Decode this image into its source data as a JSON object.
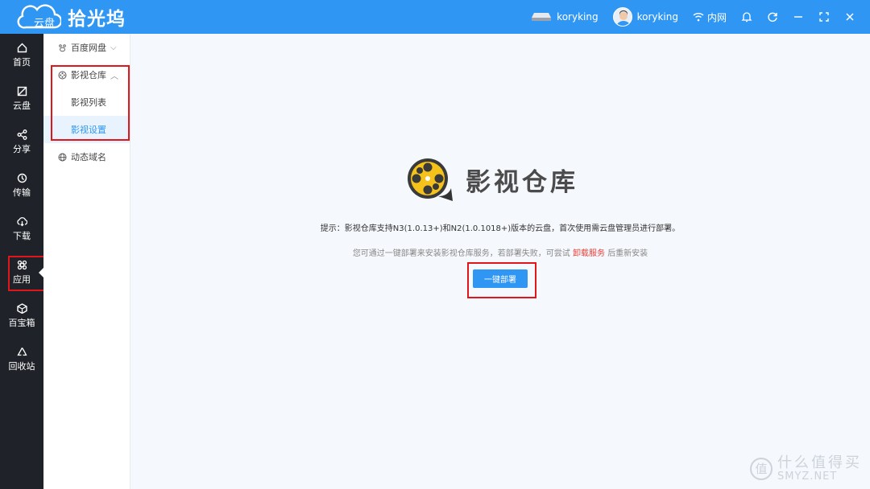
{
  "brand": {
    "cloud_text": "云盘",
    "name": "拾光坞"
  },
  "topbar": {
    "device_name": "koryking",
    "user_name": "koryking",
    "network_label": "内网"
  },
  "nav": {
    "items": [
      {
        "label": "首页",
        "icon": "home-icon"
      },
      {
        "label": "云盘",
        "icon": "cloud-drive-icon"
      },
      {
        "label": "分享",
        "icon": "share-icon"
      },
      {
        "label": "传输",
        "icon": "transfer-icon"
      },
      {
        "label": "下载",
        "icon": "download-icon"
      },
      {
        "label": "应用",
        "icon": "apps-icon"
      },
      {
        "label": "百宝箱",
        "icon": "toolbox-icon"
      },
      {
        "label": "回收站",
        "icon": "recycle-icon"
      }
    ],
    "active": "应用"
  },
  "submenu": {
    "baidu": "百度网盘",
    "video_repo": "影视仓库",
    "video_list": "影视列表",
    "video_settings": "影视设置",
    "ddns": "动态域名"
  },
  "main": {
    "title": "影视仓库",
    "tip": "提示：影视仓库支持N3(1.0.13+)和N2(1.0.1018+)版本的云盘，首次使用需云盘管理员进行部署。",
    "hint_before": "您可通过一键部署来安装影视仓库服务，若部署失败，可尝试",
    "hint_link": "卸载服务",
    "hint_after": "后重新安装",
    "deploy_button": "一键部署"
  },
  "watermark": {
    "icon": "值",
    "cn": "什么值得买",
    "en": "SMYZ.NET"
  },
  "colors": {
    "accent": "#2f97f3",
    "nav_bg": "#1f2329",
    "highlight": "#e0161b",
    "link": "#e8413a"
  }
}
